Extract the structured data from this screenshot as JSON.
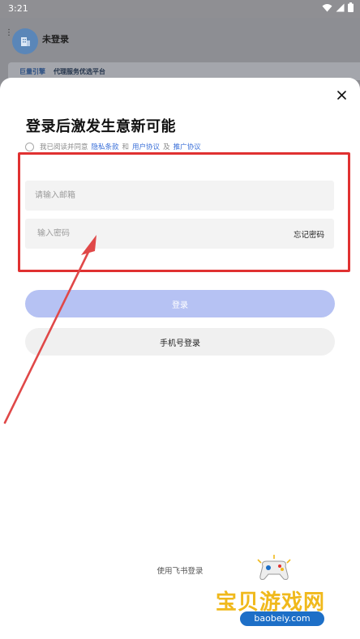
{
  "status_bar": {
    "time": "3:21"
  },
  "background_app": {
    "username": "未登录",
    "banner": {
      "brand": "巨量引擎",
      "text": "代理服务优选平台"
    }
  },
  "login_sheet": {
    "title": "登录后激发生意新可能",
    "agreement": {
      "prefix": "我已阅读并同意",
      "privacy_link": "隐私条款",
      "and": "和",
      "user_link": "用户协议",
      "and2": "及",
      "promo_link": "推广协议"
    },
    "email_placeholder": "请输入邮箱",
    "password_placeholder": "输入密码",
    "forgot_password": "忘记密码",
    "login_button": "登录",
    "phone_login_button": "手机号登录",
    "feishu_login": "使用飞书登录"
  },
  "watermark": {
    "text": "宝贝游戏网",
    "url": "baobeiy.com"
  },
  "colors": {
    "annotation_red": "#e03131",
    "login_button_disabled": "#b6c2f3",
    "link_blue": "#3a6fd8"
  }
}
